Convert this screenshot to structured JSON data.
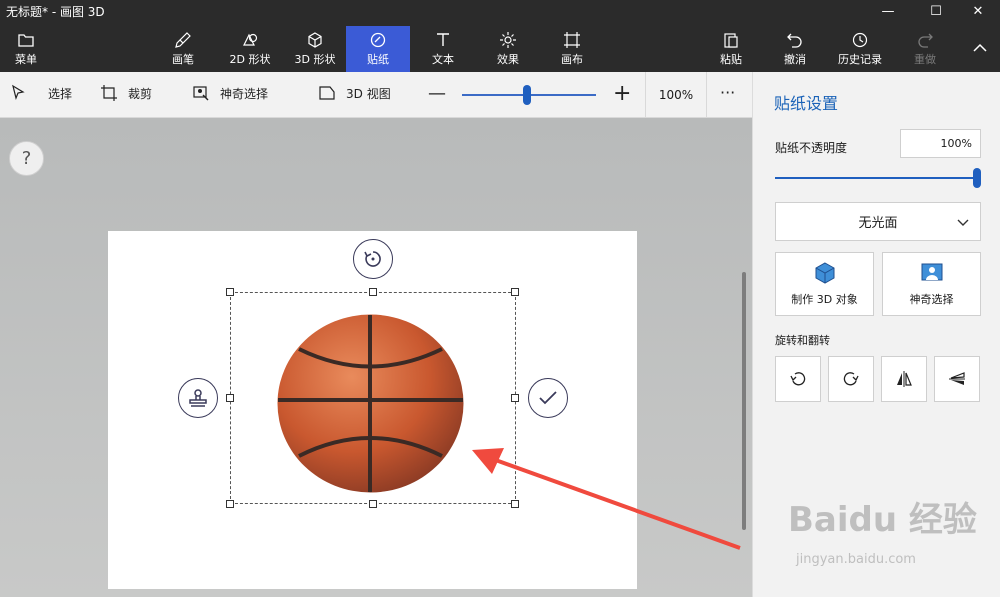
{
  "window": {
    "title": "无标题* - 画图 3D",
    "controls": [
      "minimize-icon",
      "maximize-icon",
      "close-icon"
    ]
  },
  "ribbon": {
    "menu_label": "菜单",
    "tools": [
      {
        "label": "画笔",
        "icon": "brush-icon"
      },
      {
        "label": "2D 形状",
        "icon": "shapes-2d-icon"
      },
      {
        "label": "3D 形状",
        "icon": "cube-icon"
      },
      {
        "label": "贴纸",
        "icon": "sticker-icon",
        "active": true
      },
      {
        "label": "文本",
        "icon": "text-icon"
      },
      {
        "label": "效果",
        "icon": "effects-icon"
      },
      {
        "label": "画布",
        "icon": "canvas-icon"
      }
    ],
    "right": [
      {
        "label": "粘贴",
        "icon": "paste-icon"
      },
      {
        "label": "撤消",
        "icon": "undo-icon"
      },
      {
        "label": "历史记录",
        "icon": "history-icon"
      },
      {
        "label": "重做",
        "icon": "redo-icon",
        "disabled": true
      }
    ],
    "collapse_icon": "chevron-up-icon",
    "accent": "#3b5bd6"
  },
  "toolbar": {
    "select": "选择",
    "crop": "裁剪",
    "magic_select": "神奇选择",
    "view_3d": "3D 视图",
    "zoom_value": "100%",
    "zoom_level": 0.5,
    "more": "···"
  },
  "help": "?",
  "panel": {
    "title": "贴纸设置",
    "opacity_label": "贴纸不透明度",
    "opacity_value": "100%",
    "opacity_level": 1.0,
    "finish_value": "无光面",
    "make3d": "制作 3D 对象",
    "magic_select": "神奇选择",
    "rotate_label": "旋转和翻转",
    "title_color": "#1b63b8"
  },
  "watermark": {
    "brand": "Baidu 经验",
    "url": "jingyan.baidu.com"
  }
}
